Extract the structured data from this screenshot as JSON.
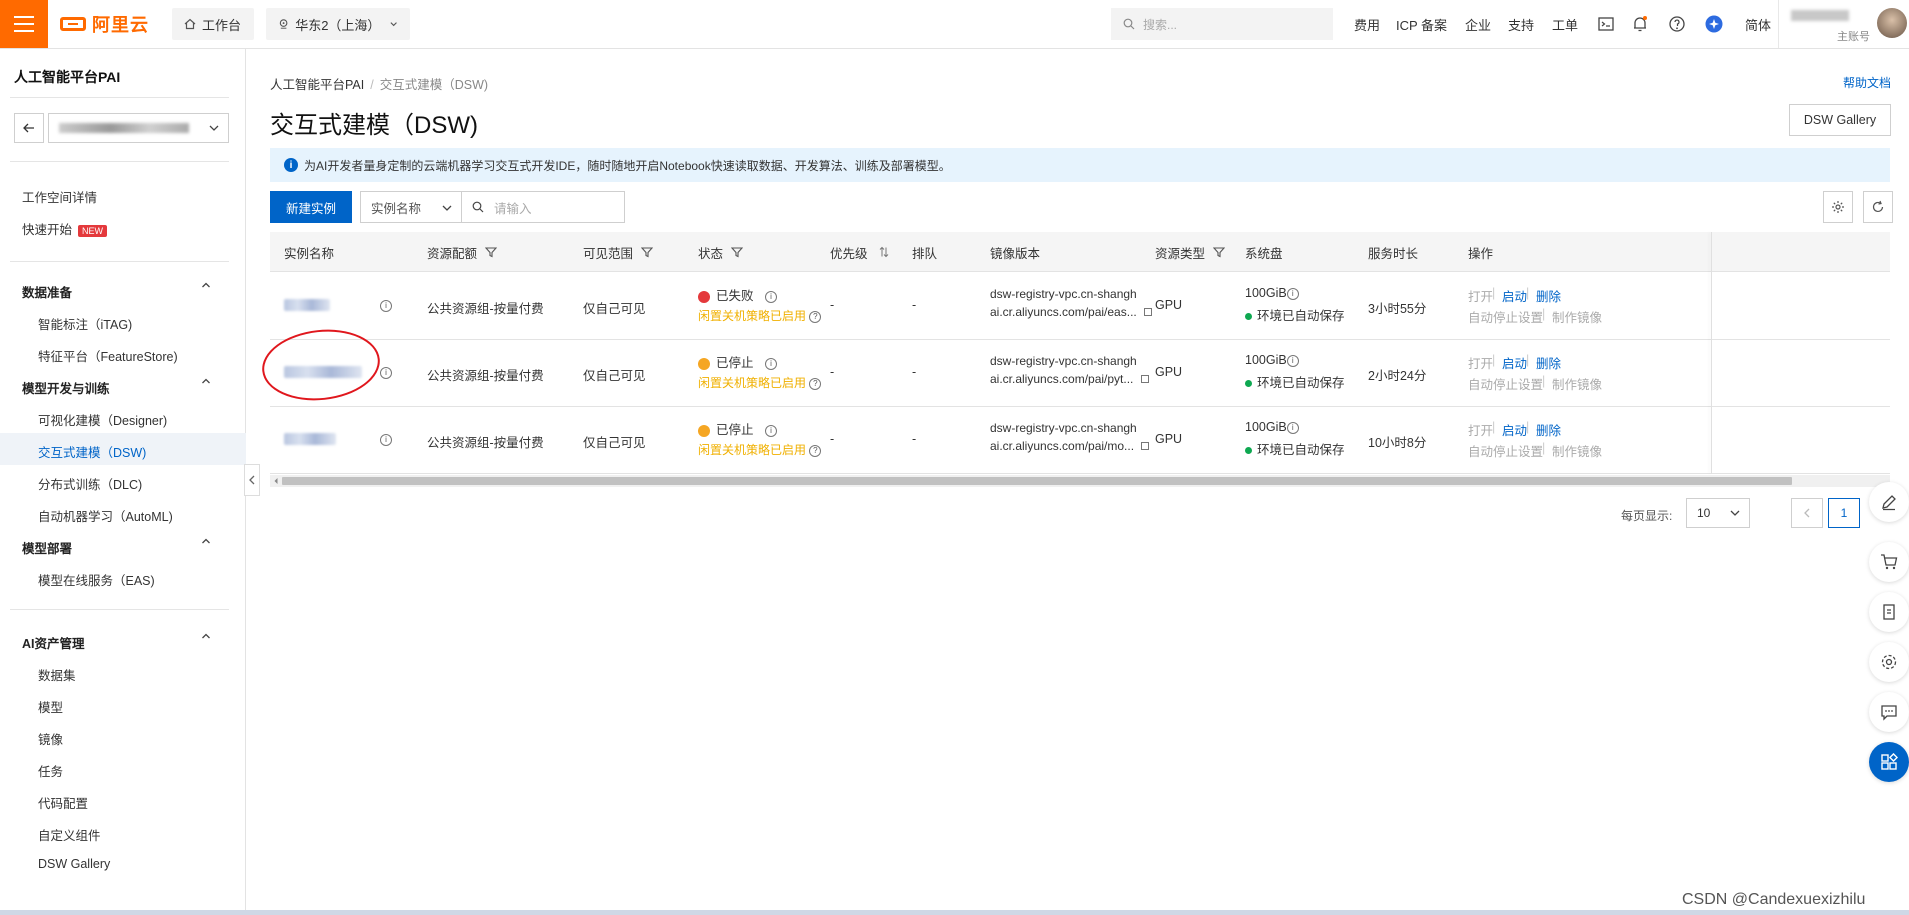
{
  "topbar": {
    "logo_text": "阿里云",
    "workbench": "工作台",
    "region": "华东2（上海）",
    "search_placeholder": "搜索...",
    "nav": [
      "费用",
      "ICP 备案",
      "企业",
      "支持",
      "工单"
    ],
    "lang": "简体",
    "account_type": "主账号"
  },
  "sidebar": {
    "title": "人工智能平台PAI",
    "items": [
      {
        "label": "工作空间详情"
      },
      {
        "label": "快速开始",
        "badge": "NEW"
      }
    ],
    "groups": [
      {
        "label": "数据准备",
        "children": [
          "智能标注（iTAG)",
          "特征平台（FeatureStore)"
        ]
      },
      {
        "label": "模型开发与训练",
        "children": [
          "可视化建模（Designer)",
          "交互式建模（DSW)",
          "分布式训练（DLC)",
          "自动机器学习（AutoML)"
        ]
      },
      {
        "label": "模型部署",
        "children": [
          "模型在线服务（EAS)"
        ]
      },
      {
        "label": "AI资产管理",
        "children": [
          "数据集",
          "模型",
          "镜像",
          "任务",
          "代码配置",
          "自定义组件",
          "DSW Gallery"
        ]
      }
    ],
    "active": "交互式建模（DSW)"
  },
  "main": {
    "breadcrumb": [
      "人工智能平台PAI",
      "交互式建模（DSW)"
    ],
    "help_link": "帮助文档",
    "title": "交互式建模（DSW)",
    "gallery_button": "DSW Gallery",
    "info": "为AI开发者量身定制的云端机器学习交互式开发IDE，随时随地开启Notebook快速读取数据、开发算法、训练及部署模型。",
    "create_button": "新建实例",
    "filter_select": "实例名称",
    "filter_placeholder": "请输入",
    "columns": [
      "实例名称",
      "资源配额",
      "可见范围",
      "状态",
      "优先级",
      "排队",
      "镜像版本",
      "资源类型",
      "系统盘",
      "服务时长",
      "操作"
    ],
    "rows": [
      {
        "quota": "公共资源组-按量付费",
        "visibility": "仅自己可见",
        "status": "已失败",
        "status_color": "#e4393c",
        "policy": "闲置关机策略已启用",
        "priority": "-",
        "queue": "-",
        "image_l1": "dsw-registry-vpc.cn-shangh",
        "image_l2": "ai.cr.aliyuncs.com/pai/eas...",
        "res_type": "GPU",
        "disk": "100GiB",
        "disk_status": "环境已自动保存",
        "duration": "3小时55分",
        "ops1": [
          "打开",
          "启动",
          "删除"
        ],
        "ops2": [
          "自动停止设置",
          "制作镜像"
        ]
      },
      {
        "quota": "公共资源组-按量付费",
        "visibility": "仅自己可见",
        "status": "已停止",
        "status_color": "#f5a623",
        "policy": "闲置关机策略已启用",
        "priority": "-",
        "queue": "-",
        "image_l1": "dsw-registry-vpc.cn-shangh",
        "image_l2": "ai.cr.aliyuncs.com/pai/pyt...",
        "res_type": "GPU",
        "disk": "100GiB",
        "disk_status": "环境已自动保存",
        "duration": "2小时24分",
        "ops1": [
          "打开",
          "启动",
          "删除"
        ],
        "ops2": [
          "自动停止设置",
          "制作镜像"
        ]
      },
      {
        "quota": "公共资源组-按量付费",
        "visibility": "仅自己可见",
        "status": "已停止",
        "status_color": "#f5a623",
        "policy": "闲置关机策略已启用",
        "priority": "-",
        "queue": "-",
        "image_l1": "dsw-registry-vpc.cn-shangh",
        "image_l2": "ai.cr.aliyuncs.com/pai/mo...",
        "res_type": "GPU",
        "disk": "100GiB",
        "disk_status": "环境已自动保存",
        "duration": "10小时8分",
        "ops1": [
          "打开",
          "启动",
          "删除"
        ],
        "ops2": [
          "自动停止设置",
          "制作镜像"
        ]
      }
    ],
    "pager": {
      "label": "每页显示:",
      "size": "10",
      "current": "1"
    }
  },
  "watermark": "CSDN @Candexuexizhilu"
}
